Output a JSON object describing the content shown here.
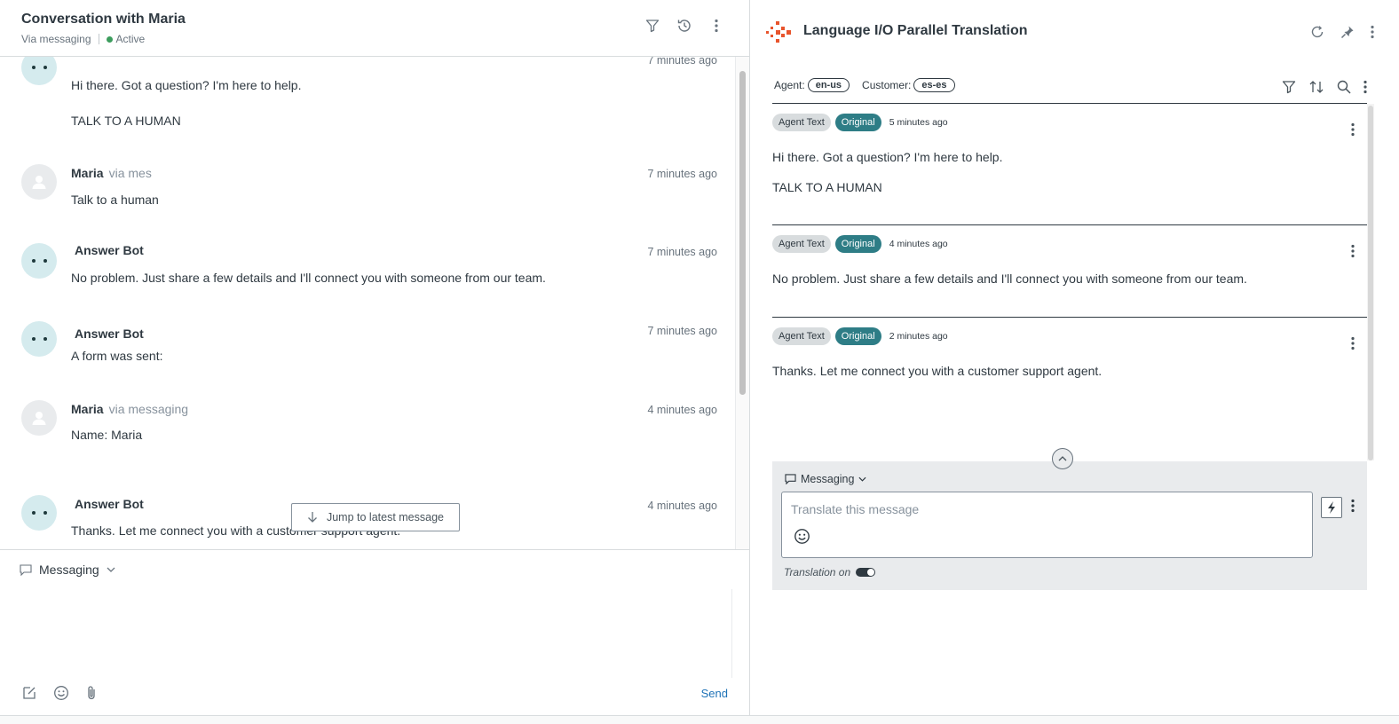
{
  "left": {
    "title": "Conversation with Maria",
    "channel": "Via messaging",
    "status": "Active",
    "messages": [
      {
        "sender": "",
        "via": "",
        "time": "7 minutes ago",
        "lines": [
          "Hi there. Got a question? I'm here to help.",
          "TALK TO A HUMAN"
        ]
      },
      {
        "sender": "Maria",
        "via": "via mes",
        "time": "7 minutes ago",
        "lines": [
          "Talk to a human"
        ]
      },
      {
        "sender": "Answer Bot",
        "via": "",
        "time": "7 minutes ago",
        "lines": [
          "No problem. Just share a few details and I'll connect you with someone from our team."
        ]
      },
      {
        "sender": "Answer Bot",
        "via": "",
        "time": "7 minutes ago",
        "lines": [
          "A form was sent:"
        ]
      },
      {
        "sender": "Maria",
        "via": "via messaging",
        "time": "4 minutes ago",
        "lines": [
          "Name: Maria"
        ]
      },
      {
        "sender": "Answer Bot",
        "via": "",
        "time": "4 minutes ago",
        "lines": [
          "Thanks. Let me connect you with a customer support agent."
        ]
      }
    ],
    "jump_label": "Jump to latest message",
    "composer": {
      "channel": "Messaging",
      "send": "Send"
    }
  },
  "right": {
    "title": "Language I/O Parallel Translation",
    "agent_label": "Agent:",
    "agent_lang": "en-us",
    "customer_label": "Customer:",
    "customer_lang": "es-es",
    "entries": [
      {
        "badge1": "Agent Text",
        "badge2": "Original",
        "time": "5 minutes ago",
        "lines": [
          "Hi there. Got a question? I'm here to help.",
          "TALK TO A HUMAN"
        ]
      },
      {
        "badge1": "Agent Text",
        "badge2": "Original",
        "time": "4 minutes ago",
        "lines": [
          "No problem. Just share a few details and I'll connect you with someone from our team."
        ]
      },
      {
        "badge1": "Agent Text",
        "badge2": "Original",
        "time": "2 minutes ago",
        "lines": [
          "Thanks. Let me connect you with a customer support agent."
        ]
      }
    ],
    "composer": {
      "channel": "Messaging",
      "placeholder": "Translate this message",
      "translation_status": "Translation on"
    }
  }
}
